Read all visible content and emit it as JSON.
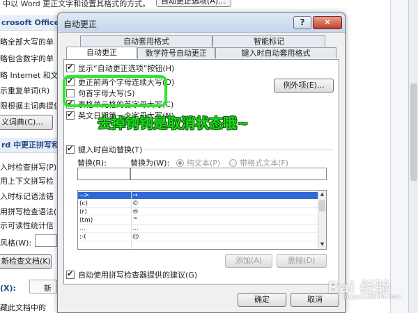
{
  "background": {
    "top_text": "中以 Word 更正文字和设置其格式的方式。",
    "top_button": "自动更正选项(A)...",
    "section1_title": "crosoft Office 程",
    "lines1": [
      "略全部大写的单",
      "略包含数字的单",
      "略 Internet 和文",
      "示重复单词(R)",
      "限根据主词典提供"
    ],
    "dict_button": "义词典(C)...",
    "section2_title": "rd 中更正拼写和",
    "lines2": [
      "入时检查拼写(P)",
      "用上下文拼写检",
      "入时标记语法错",
      "用拼写检查语法(",
      "示可读性统计信"
    ],
    "style_label": "风格(W):",
    "recheck_button": "新检查文档(K)",
    "exceptions_label": "(X):",
    "new_doc_label": "新",
    "bottom_line": "藏此文档中的"
  },
  "dialog": {
    "title": "自动更正",
    "tabs_row1": [
      "自动套用格式",
      "智能标记"
    ],
    "tabs_row2": [
      "自动更正",
      "数学符号自动更正",
      "键入时自动套用格式"
    ],
    "checkboxes": [
      {
        "label": "显示“自动更正选项”按钮(H)",
        "checked": true
      },
      {
        "label": "更正前两个字母连续大写(O)",
        "checked": true
      },
      {
        "label": "句首字母大写(S)",
        "checked": false
      },
      {
        "label": "表格单元格的首字母大写(C)",
        "checked": true
      },
      {
        "label": "英文日期第一个字母大写(N)",
        "checked": true
      }
    ],
    "exceptions_button": "例外项(E)...",
    "replace_while_typing": {
      "label": "键入时自动替换(T)",
      "checked": true
    },
    "replace_label": "替换(R):",
    "replace_with_label": "替换为(W):",
    "plain_text_label": "纯文本(P)",
    "formatted_text_label": "带格式文本(F)",
    "list_rows": [
      {
        "from": "-->",
        "to": "→"
      },
      {
        "from": "(c)",
        "to": "©"
      },
      {
        "from": "(r)",
        "to": "®"
      },
      {
        "from": "(tm)",
        "to": "™"
      },
      {
        "from": "...",
        "to": "…"
      },
      {
        "from": ":-(",
        "to": "☹"
      }
    ],
    "add_button": "添加(A)",
    "delete_button": "删除(D)",
    "spell_suggest": {
      "label": "自动使用拼写检查器提供的建议(G)",
      "checked": true
    },
    "ok_button": "确定",
    "cancel_button": "取消"
  },
  "annotation_text": "去掉钩钩是取消状态哦~",
  "watermark": {
    "main": "Bai 经验",
    "sub": "jingyan.baidu.com"
  },
  "colors": {
    "highlight": "#2ee82e",
    "annotation": "#1bd81b",
    "selection": "#3068d8"
  }
}
